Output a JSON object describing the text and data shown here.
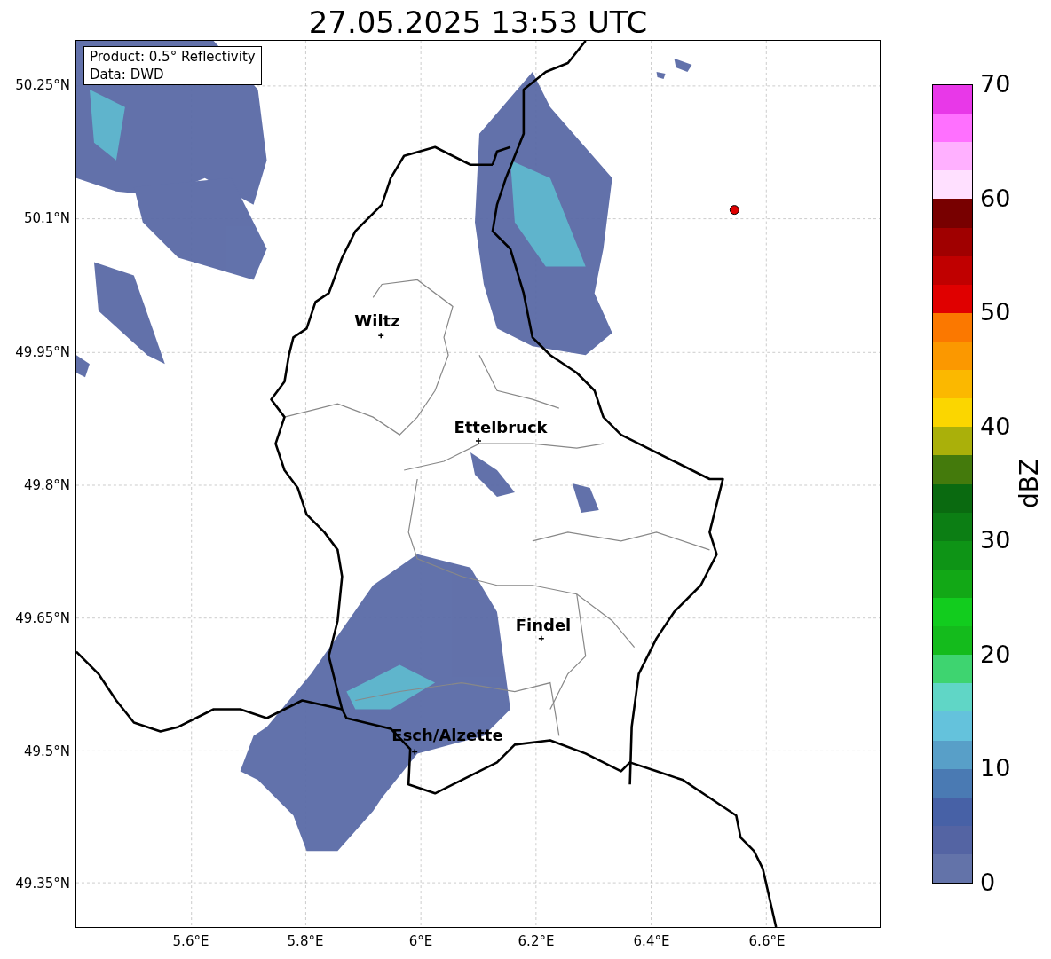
{
  "title": "27.05.2025 13:53 UTC",
  "info_box": [
    "Product: 0.5° Reflectivity",
    "Data: DWD"
  ],
  "map": {
    "kind": "map",
    "cities": [
      {
        "name": "Wiltz"
      },
      {
        "name": "Ettelbruck"
      },
      {
        "name": "Findel"
      },
      {
        "name": "Esch/Alzette"
      }
    ]
  },
  "yticks": [
    "50.25°N",
    "50.1°N",
    "49.95°N",
    "49.8°N",
    "49.65°N",
    "49.5°N",
    "49.35°N"
  ],
  "xticks": [
    "5.6°E",
    "5.8°E",
    "6°E",
    "6.2°E",
    "6.4°E",
    "6.6°E"
  ],
  "colorbar": {
    "label": "dBZ",
    "ticks": [
      "70",
      "60",
      "50",
      "40",
      "30",
      "20",
      "10",
      "0"
    ],
    "bins": [
      {
        "color": "#e838e8"
      },
      {
        "color": "#ff70ff"
      },
      {
        "color": "#ffb0ff"
      },
      {
        "color": "#ffe0ff"
      },
      {
        "color": "#780000"
      },
      {
        "color": "#a00000"
      },
      {
        "color": "#c00000"
      },
      {
        "color": "#e00000"
      },
      {
        "color": "#fb7800"
      },
      {
        "color": "#fb9800"
      },
      {
        "color": "#fbb800"
      },
      {
        "color": "#fbd600"
      },
      {
        "color": "#aab00a"
      },
      {
        "color": "#447a0c"
      },
      {
        "color": "#0a6a10"
      },
      {
        "color": "#0c7e14"
      },
      {
        "color": "#0e9416"
      },
      {
        "color": "#12a816"
      },
      {
        "color": "#12cc1e"
      },
      {
        "color": "#14bb1c"
      },
      {
        "color": "#3ed470"
      },
      {
        "color": "#60d6c6"
      },
      {
        "color": "#64c2dc"
      },
      {
        "color": "#589fc8"
      },
      {
        "color": "#4a7ab3"
      },
      {
        "color": "#4761a6"
      },
      {
        "color": "#5464a3"
      },
      {
        "color": "#6373a9"
      }
    ]
  }
}
